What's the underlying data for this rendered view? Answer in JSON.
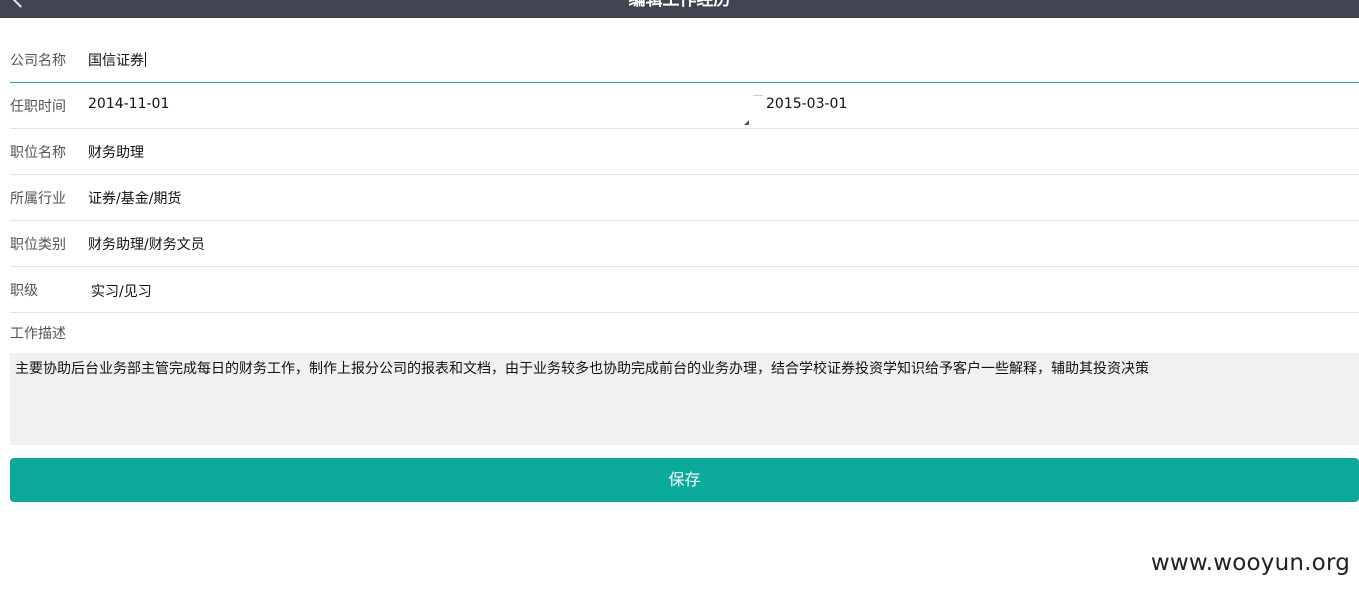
{
  "header": {
    "title": "编辑工作经历",
    "back_icon": "chevron-left-icon"
  },
  "form": {
    "company": {
      "label": "公司名称",
      "value": "国信证券"
    },
    "tenure": {
      "label": "任职时间",
      "start": "2014-11-01",
      "end": "2015-03-01"
    },
    "position": {
      "label": "职位名称",
      "value": "财务助理"
    },
    "industry": {
      "label": "所属行业",
      "value": "证券/基金/期货"
    },
    "category": {
      "label": "职位类别",
      "value": "财务助理/财务文员"
    },
    "rank": {
      "label": "职级",
      "value": "实习/见习"
    },
    "description": {
      "label": "工作描述",
      "value": "主要协助后台业务部主管完成每日的财务工作，制作上报分公司的报表和文档，由于业务较多也协助完成前台的业务办理，结合学校证券投资学知识给予客户一些解释，辅助其投资决策"
    }
  },
  "actions": {
    "save_label": "保存"
  },
  "watermark": "www.wooyun.org",
  "colors": {
    "topbar": "#3f4450",
    "accent": "#0aa99a",
    "textarea_bg": "#f0f1f3"
  }
}
